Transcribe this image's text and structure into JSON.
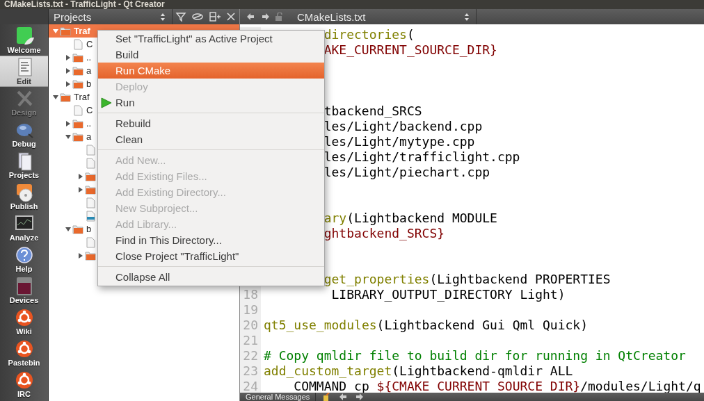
{
  "window": {
    "title": "CMakeLists.txt - TrafficLight - Qt Creator"
  },
  "mode_bar": [
    {
      "label": "Welcome",
      "selected": false,
      "disabled": false
    },
    {
      "label": "Edit",
      "selected": true,
      "disabled": false
    },
    {
      "label": "Design",
      "selected": false,
      "disabled": true
    },
    {
      "label": "Debug",
      "selected": false,
      "disabled": false
    },
    {
      "label": "Projects",
      "selected": false,
      "disabled": false
    },
    {
      "label": "Publish",
      "selected": false,
      "disabled": false
    },
    {
      "label": "Analyze",
      "selected": false,
      "disabled": false
    },
    {
      "label": "Help",
      "selected": false,
      "disabled": false
    },
    {
      "label": "Devices",
      "selected": false,
      "disabled": false
    },
    {
      "label": "Wiki",
      "selected": false,
      "disabled": false
    },
    {
      "label": "Pastebin",
      "selected": false,
      "disabled": false
    },
    {
      "label": "IRC",
      "selected": false,
      "disabled": false
    }
  ],
  "projects_panel": {
    "title": "Projects",
    "tree": [
      {
        "kind": "folder",
        "label": "Traf",
        "expanded": true,
        "selected": true,
        "children": [
          {
            "kind": "file",
            "label": "C",
            "selected": false
          },
          {
            "kind": "folder",
            "label": "..",
            "expanded": false,
            "selected": false
          },
          {
            "kind": "folder",
            "label": "a",
            "expanded": false,
            "selected": false
          },
          {
            "kind": "folder",
            "label": "b",
            "expanded": false,
            "selected": false
          }
        ]
      },
      {
        "kind": "folder",
        "label": "Traf",
        "expanded": true,
        "selected": false,
        "children": [
          {
            "kind": "file",
            "label": "C",
            "selected": false
          },
          {
            "kind": "folder",
            "label": "..",
            "expanded": false,
            "selected": false
          },
          {
            "kind": "folder",
            "label": "a",
            "expanded": true,
            "selected": false,
            "children": [
              {
                "kind": "file",
                "selected": false
              },
              {
                "kind": "file",
                "selected": false
              },
              {
                "kind": "folder",
                "expanded": false,
                "selected": false
              },
              {
                "kind": "folder",
                "expanded": false,
                "selected": false
              },
              {
                "kind": "file",
                "selected": false
              },
              {
                "kind": "qml",
                "selected": false
              }
            ]
          },
          {
            "kind": "folder",
            "label": "b",
            "expanded": true,
            "selected": false,
            "children": [
              {
                "kind": "file",
                "selected": false
              },
              {
                "kind": "folder",
                "expanded": false,
                "selected": false
              }
            ]
          }
        ]
      }
    ]
  },
  "editor": {
    "file": "CMakeLists.txt",
    "lines": [
      {
        "segments": [
          {
            "kind": "function",
            "text": "directories"
          },
          {
            "kind": "plain",
            "text": "("
          }
        ]
      },
      {
        "segments": [
          {
            "kind": "variable",
            "text": "AKE_CURRENT_SOURCE_DIR}"
          }
        ]
      },
      {
        "segments": [
          {
            "kind": "plain",
            "text": "tbackend_SRCS"
          }
        ]
      },
      {
        "segments": [
          {
            "kind": "plain",
            "text": "les/Light/backend.cpp"
          }
        ]
      },
      {
        "segments": [
          {
            "kind": "plain",
            "text": "les/Light/mytype.cpp"
          }
        ]
      },
      {
        "segments": [
          {
            "kind": "plain",
            "text": "les/Light/trafficlight.cpp"
          }
        ]
      },
      {
        "segments": [
          {
            "kind": "plain",
            "text": "les/Light/piechart.cpp"
          }
        ]
      },
      {
        "segments": [
          {
            "kind": "function",
            "text": "ary"
          },
          {
            "kind": "plain",
            "text": "(Lightbackend MODULE"
          }
        ]
      },
      {
        "segments": [
          {
            "kind": "variable",
            "text": "ghtbackend_SRCS}"
          }
        ]
      },
      {
        "segments": [
          {
            "kind": "function",
            "text": "get_properties"
          },
          {
            "kind": "plain",
            "text": "(Lightbackend PROPERTIES"
          }
        ]
      },
      {
        "number": "18",
        "segments": [
          {
            "kind": "plain",
            "text": "         LIBRARY_OUTPUT_DIRECTORY Light)"
          }
        ]
      },
      {
        "number": "19"
      },
      {
        "number": "20",
        "segments": [
          {
            "kind": "function",
            "text": "qt5_use_modules"
          },
          {
            "kind": "plain",
            "text": "(Lightbackend Gui Qml Quick)"
          }
        ]
      },
      {
        "number": "21"
      },
      {
        "number": "22",
        "segments": [
          {
            "kind": "comment",
            "text": "# Copy qmldir file to build dir for running in QtCreator"
          }
        ]
      },
      {
        "number": "23",
        "segments": [
          {
            "kind": "function",
            "text": "add_custom_target"
          },
          {
            "kind": "plain",
            "text": "(Lightbackend-qmldir ALL"
          }
        ]
      },
      {
        "number": "24",
        "segments": [
          {
            "kind": "plain",
            "text": "    COMMAND cp "
          },
          {
            "kind": "variable",
            "text": "${CMAKE_CURRENT_SOURCE_DIR}"
          },
          {
            "kind": "plain",
            "text": "/modules/Light/q"
          }
        ]
      }
    ]
  },
  "output_bar": {
    "tab": "General Messages"
  },
  "context_menu": [
    {
      "kind": "item",
      "label": "Set \"TrafficLight\" as Active Project",
      "disabled": false,
      "selected": false
    },
    {
      "kind": "item",
      "label": "Build",
      "disabled": false,
      "selected": false
    },
    {
      "kind": "item",
      "label": "Run CMake",
      "disabled": false,
      "selected": true
    },
    {
      "kind": "item",
      "label": "Deploy",
      "disabled": true,
      "selected": false
    },
    {
      "kind": "icon_item",
      "label": "Run",
      "disabled": false,
      "selected": false
    },
    {
      "kind": "separator"
    },
    {
      "kind": "item",
      "label": "Rebuild",
      "disabled": false,
      "selected": false
    },
    {
      "kind": "item",
      "label": "Clean",
      "disabled": false,
      "selected": false
    },
    {
      "kind": "separator"
    },
    {
      "kind": "item",
      "label": "Add New...",
      "disabled": true,
      "selected": false
    },
    {
      "kind": "item",
      "label": "Add Existing Files...",
      "disabled": true,
      "selected": false
    },
    {
      "kind": "item",
      "label": "Add Existing Directory...",
      "disabled": true,
      "selected": false
    },
    {
      "kind": "item",
      "label": "New Subproject...",
      "disabled": true,
      "selected": false
    },
    {
      "kind": "item",
      "label": "Add Library...",
      "disabled": true,
      "selected": false
    },
    {
      "kind": "item",
      "label": "Find in This Directory...",
      "disabled": false,
      "selected": false
    },
    {
      "kind": "item",
      "label": "Close Project \"TrafficLight\"",
      "disabled": false,
      "selected": false
    },
    {
      "kind": "separator"
    },
    {
      "kind": "item",
      "label": "Collapse All",
      "disabled": false,
      "selected": false
    }
  ]
}
